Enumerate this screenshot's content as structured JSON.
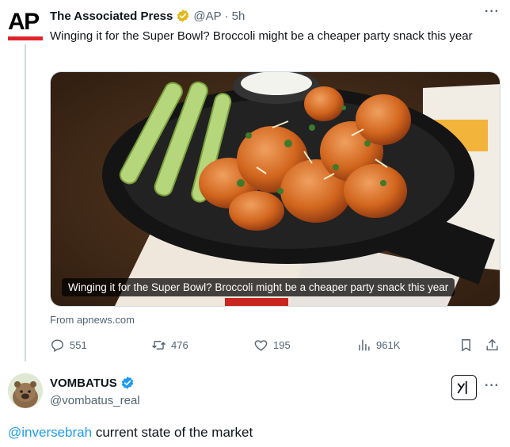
{
  "tweet1": {
    "author_name": "The Associated Press",
    "author_handle": "@AP",
    "separator": "·",
    "time": "5h",
    "text": "Winging it for the Super Bowl? Broccoli might be a cheaper party snack this year",
    "avatar_text": "AP",
    "media_caption": "Winging it for the Super Bowl? Broccoli might be a cheaper party snack this year",
    "source": "From apnews.com",
    "stats": {
      "replies": "551",
      "reposts": "476",
      "likes": "195",
      "views": "961K"
    }
  },
  "tweet2": {
    "author_name": "VOMBATUS",
    "author_handle": "@vombatus_real",
    "mention": "@inversebrah",
    "text": " current state of the market"
  },
  "colors": {
    "accent": "#1d9bf0",
    "gold_badge": "#e2b719",
    "ap_red": "#e0232a",
    "muted": "#536471"
  }
}
